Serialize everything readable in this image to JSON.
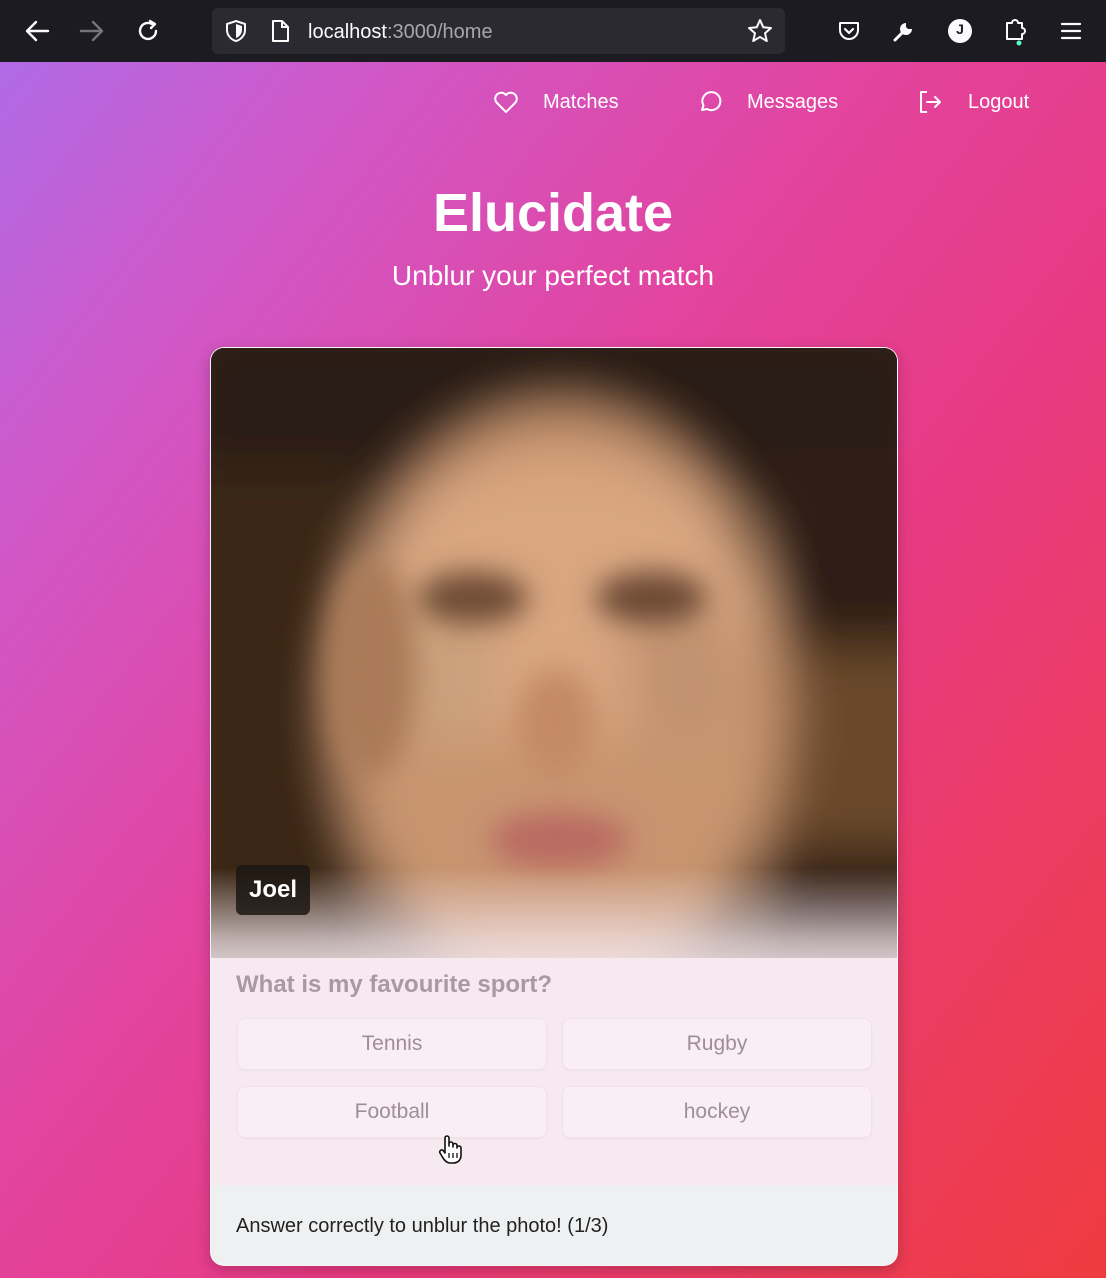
{
  "browser": {
    "url_host": "localhost",
    "url_path": ":3000/home",
    "profile_initial": "J"
  },
  "nav": {
    "matches": "Matches",
    "messages": "Messages",
    "logout": "Logout"
  },
  "header": {
    "title": "Elucidate",
    "subtitle": "Unblur your perfect match"
  },
  "profile": {
    "name": "Joel",
    "question": "What is my favourite sport?",
    "answers": [
      "Tennis",
      "Rugby",
      "Football",
      "hockey"
    ],
    "status": "Answer correctly to unblur the photo! (1/3)"
  },
  "colors": {
    "gradient_start": "#b06ae6",
    "gradient_mid": "#e2449f",
    "gradient_end": "#ee3b3f"
  }
}
